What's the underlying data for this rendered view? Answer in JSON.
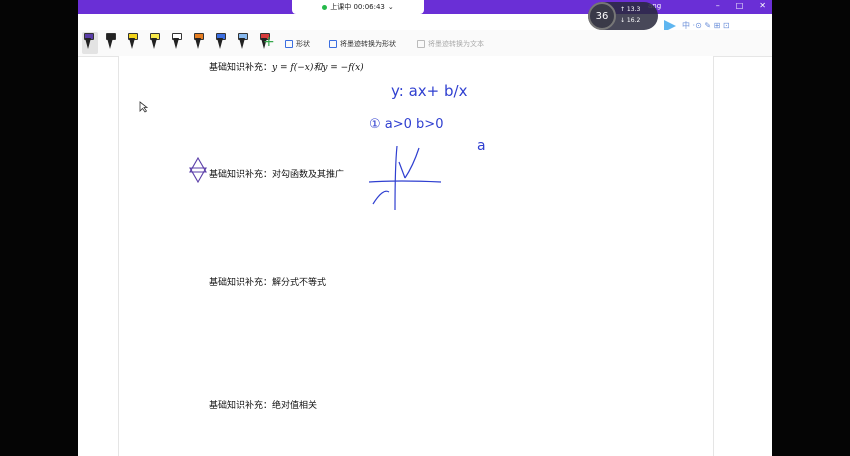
{
  "titlebar": {
    "live_status": "上课中 00:06:43",
    "user_fragment": "ang",
    "buttons": {
      "minimize": "–",
      "maximize": "□",
      "close": "✕"
    }
  },
  "network": {
    "badge": "36",
    "upload": "↑ 13.3",
    "download": "↓ 16.2"
  },
  "tray_text": "中 ·⊙ ✎ ⊞ ⊡",
  "toolbar": {
    "pens": [
      {
        "name": "purple-pen",
        "cap": "#5a3da8"
      },
      {
        "name": "black-pen",
        "cap": "#222222"
      },
      {
        "name": "yellow-pen",
        "cap": "#f2d31b"
      },
      {
        "name": "yellow-highlighter",
        "cap": "#f6e84a"
      },
      {
        "name": "white-pen",
        "cap": "#ffffff"
      },
      {
        "name": "orange-pen",
        "cap": "#e67e22"
      },
      {
        "name": "blue-pen",
        "cap": "#3b6ee0"
      },
      {
        "name": "light-blue-pen",
        "cap": "#88b9ee"
      },
      {
        "name": "red-pen",
        "cap": "#d63a3a"
      }
    ],
    "shape_label": "形状",
    "ink_to_shape_label": "将墨迹转换为形状",
    "ink_to_text_label": "将墨迹转换为文本"
  },
  "content": {
    "section1": {
      "prefix": "基础知识补充：",
      "math": "y = f(−x)和y = −f(x)"
    },
    "section2": {
      "prefix": "基础知识补充：",
      "text": "对勾函数及其推广"
    },
    "section3": {
      "prefix": "基础知识补充：",
      "text": "解分式不等式"
    },
    "section4": {
      "prefix": "基础知识补充：",
      "text": "绝对值相关"
    }
  },
  "handwriting": {
    "formula": "y: ax+ b/x",
    "condition": "① a>0 b>0",
    "note": "a"
  }
}
